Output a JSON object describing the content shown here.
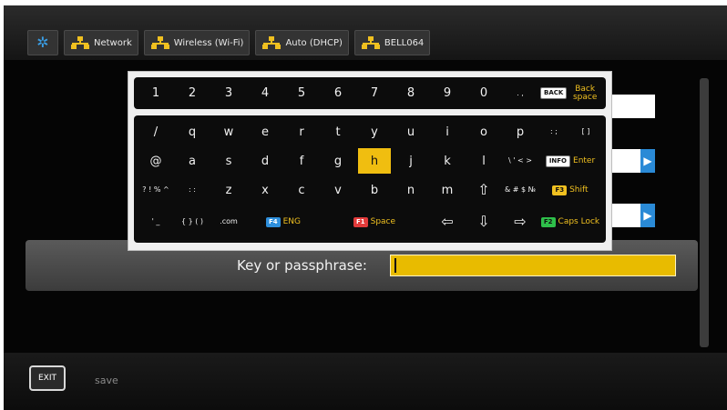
{
  "breadcrumbs": [
    {
      "icon": "gear-icon",
      "label": ""
    },
    {
      "icon": "network-icon",
      "label": "Network"
    },
    {
      "icon": "network-icon",
      "label": "Wireless (Wi-Fi)"
    },
    {
      "icon": "network-icon",
      "label": "Auto (DHCP)"
    },
    {
      "icon": "network-icon",
      "label": "BELL064"
    }
  ],
  "keyboard": {
    "top_row": [
      "1",
      "2",
      "3",
      "4",
      "5",
      "6",
      "7",
      "8",
      "9",
      "0"
    ],
    "top_symbols": ". ,",
    "back_badge": "BACK",
    "back_label": "Back space",
    "row1": [
      "/",
      "q",
      "w",
      "e",
      "r",
      "t",
      "y",
      "u",
      "i",
      "o",
      "p"
    ],
    "row1_symbols": ": ;",
    "row1_brackets": "[ ]",
    "row2": [
      "@",
      "a",
      "s",
      "d",
      "f",
      "g",
      "h",
      "j",
      "k",
      "l"
    ],
    "row2_symbols": "\\ ' < >",
    "row2_badge": "INFO",
    "row2_label": "Enter",
    "row3_sym1": "? ! % ^",
    "row3_sym2": ": :",
    "row3": [
      "z",
      "x",
      "c",
      "v",
      "b",
      "n",
      "m"
    ],
    "shift_arrow": "⇧",
    "row3_sym3": "& # $ №",
    "row3_badge": "F3",
    "row3_label": "Shift",
    "row4_sym1": "' _",
    "row4_sym2": "{ } ( )",
    "dotcom": ".com",
    "f4_badge": "F4",
    "f4_label": "ENG",
    "f1_badge": "F1",
    "f1_label": "Space",
    "arrows": [
      "⇦",
      "⇩",
      "⇨"
    ],
    "f2_badge": "F2",
    "f2_label": "Caps Lock",
    "highlighted_key": "h"
  },
  "passphrase": {
    "label": "Key or passphrase:",
    "value": ""
  },
  "right_arrow": "▶",
  "bottom": {
    "exit_badge": "EXIT",
    "save_label": "save"
  },
  "colors": {
    "accent": "#f0be10",
    "blue": "#2a8ad6"
  }
}
